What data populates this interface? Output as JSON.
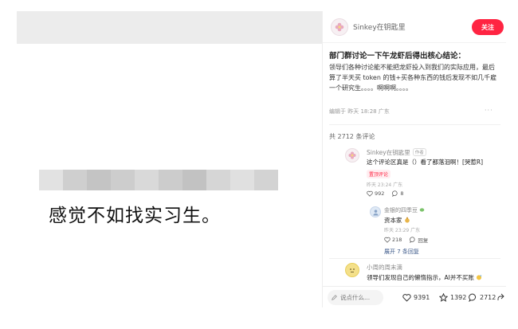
{
  "image": {
    "caption": "感觉不如找实习生。",
    "blur_colors": [
      "#e2e2e2",
      "#cfcfcf",
      "#c4c4c4",
      "#cdcdcd",
      "#d9d9d9",
      "#cccccc",
      "#c2c2c2",
      "#d6d6d6",
      "#e0e0e0",
      "#d3d3d3"
    ]
  },
  "author": {
    "name": "Sinkey在钥匙里"
  },
  "follow_label": "关注",
  "post": {
    "title": "部门群讨论一下午龙虾后得出核心结论：",
    "body": "领导们各种讨论能不能把龙虾投入到我们的实际应用，最后算了半天买 token 的钱+买各种东西的钱后发现不如几千雇一个研究生。。。。啊啊啊。。。。",
    "meta": "编辑于 昨天 18:28 广东"
  },
  "comment_count_label": "共 2712 条评论",
  "comments": [
    {
      "name": "Sinkey在钥匙里",
      "author_tag": "作者",
      "text": "这个评论区真是（）看了都落泪啊！[哭惹R]",
      "badge": "置顶评论",
      "meta": "昨天 23:24 广东",
      "likes": "992",
      "replies": "8"
    },
    {
      "name": "金银的四季豆",
      "text": "资本家",
      "meta": "昨天 23:29 广东",
      "likes": "218",
      "reply_label": "回复"
    },
    {
      "name": "小周的周末滴",
      "text": "领导们发现自己的懒惰指示，AI并不买账"
    }
  ],
  "expand_label": "展开 7 条回复",
  "input": {
    "placeholder": "说点什么..."
  },
  "stats": {
    "likes": "9391",
    "stars": "1392",
    "comments": "2712"
  },
  "more_dots": "···",
  "colors": {
    "accent": "#ff2442",
    "link": "#3d5a8a"
  }
}
